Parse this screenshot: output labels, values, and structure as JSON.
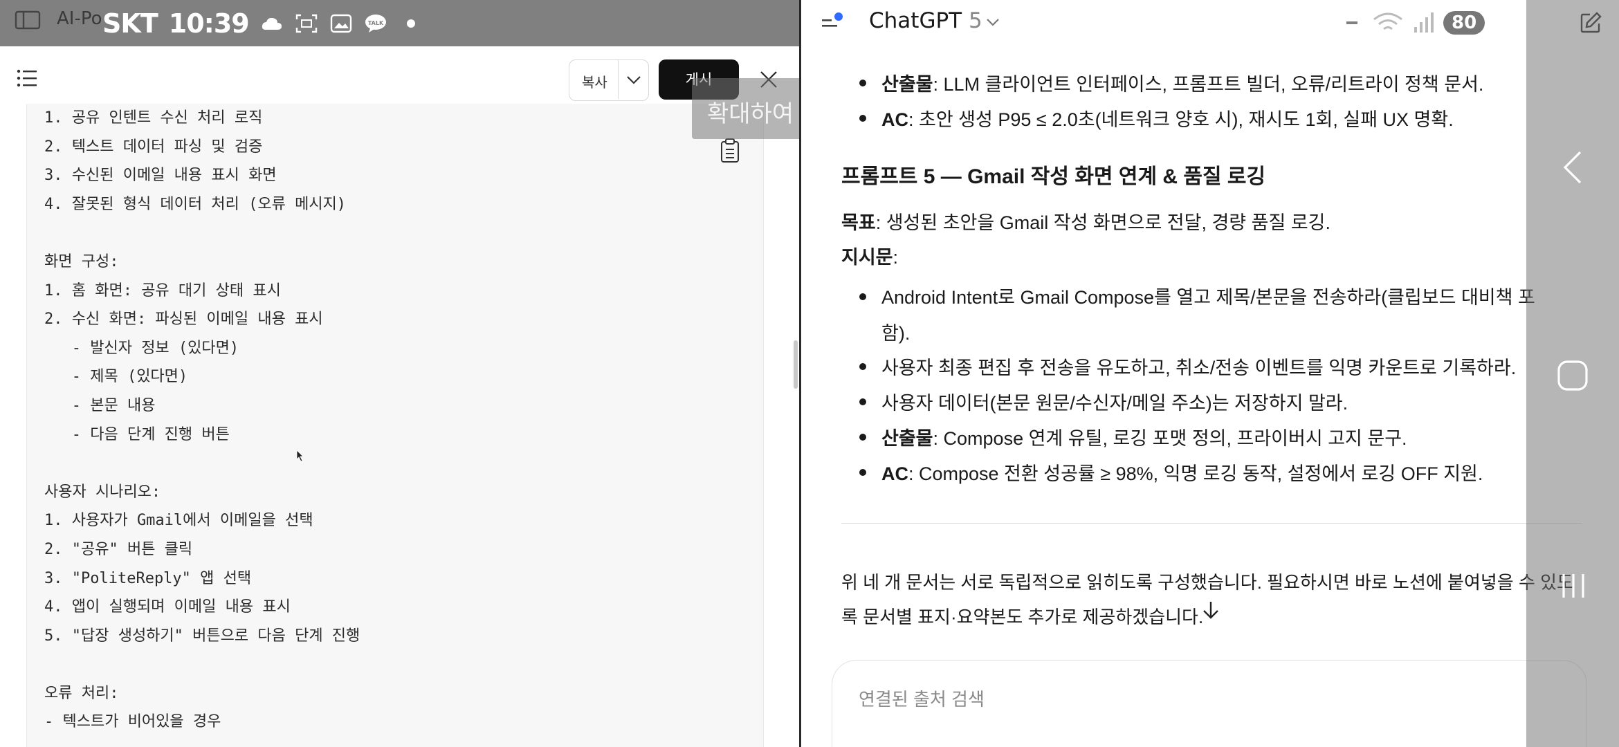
{
  "status_bar": {
    "carrier": "SKT",
    "time": "10:39",
    "battery": "80",
    "talk_badge": "TALK"
  },
  "left_pane": {
    "tab_title": "AI-Po",
    "copy_label": "복사",
    "post_label": "게시",
    "toast_text": "확대하여 화면 채움",
    "doc_lines": [
      "1. 공유 인텐트 수신 처리 로직",
      "2. 텍스트 데이터 파싱 및 검증",
      "3. 수신된 이메일 내용 표시 화면",
      "4. 잘못된 형식 데이터 처리 (오류 메시지)",
      "",
      "화면 구성:",
      "1. 홈 화면: 공유 대기 상태 표시",
      "2. 수신 화면: 파싱된 이메일 내용 표시",
      "   - 발신자 정보 (있다면)",
      "   - 제목 (있다면)",
      "   - 본문 내용",
      "   - 다음 단계 진행 버튼",
      "",
      "사용자 시나리오:",
      "1. 사용자가 Gmail에서 이메일을 선택",
      "2. \"공유\" 버튼 클릭",
      "3. \"PoliteReply\" 앱 선택",
      "4. 앱이 실행되며 이메일 내용 표시",
      "5. \"답장 생성하기\" 버튼으로 다음 단계 진행",
      "",
      "오류 처리:",
      "- 텍스트가 비어있을 경우"
    ]
  },
  "right_pane": {
    "app_name": "ChatGPT",
    "model_version": "5",
    "bullets_top": [
      {
        "bold": "산출물",
        "text": ": LLM 클라이언트 인터페이스, 프롬프트 빌더, 오류/리트라이 정책 문서."
      },
      {
        "bold": "AC",
        "text": ": 초안 생성 P95 ≤ 2.0초(네트워크 양호 시), 재시도 1회, 실패 UX 명확."
      }
    ],
    "section_heading": "프롬프트 5 — Gmail 작성 화면 연계 & 품질 로깅",
    "goal_label": "목표",
    "goal_text": ": 생성된 초안을 Gmail 작성 화면으로 전달, 경량 품질 로깅.",
    "instructions_label": "지시문",
    "instructions_colon": ":",
    "bullets_main": [
      {
        "bold": "",
        "line1": "Android Intent로 Gmail Compose를 열고 제목/본문을 전송하라(클립보드 대비책 포",
        "line2": "함)."
      },
      {
        "bold": "",
        "line1": "사용자 최종 편집 후 전송을 유도하고, 취소/전송 이벤트를 익명 카운트로 기록하라.",
        "line2": ""
      },
      {
        "bold": "",
        "line1": "사용자 데이터(본문 원문/수신자/메일 주소)는 저장하지 말라.",
        "line2": ""
      },
      {
        "bold": "산출물",
        "line1": ": Compose 연계 유틸, 로깅 포맷 정의, 프라이버시 고지 문구.",
        "line2": ""
      },
      {
        "bold": "AC",
        "line1": ": Compose 전환 성공률 ≥ 98%, 익명 로깅 동작, 설정에서 로깅 OFF 지원.",
        "line2": ""
      }
    ],
    "closing_line1": "위 네 개 문서는 서로 독립적으로 읽히도록 구성했습니다. 필요하시면 바로 노션에 붙여넣을 수 있도",
    "closing_line2": "록 문서별 표지·요약본도 추가로 제공하겠습니다.",
    "composer_placeholder": "연결된 출처 검색"
  },
  "icons": [
    "sidebar-icon",
    "cloud-icon",
    "screenshot-icon",
    "gallery-icon",
    "talk-icon",
    "outline-icon",
    "chevron-down-icon",
    "close-icon",
    "clipboard-icon",
    "hamburger-icon",
    "mute-icon",
    "wifi-icon",
    "signal-icon",
    "edit-icon",
    "arrow-down-icon",
    "back-icon",
    "home-icon",
    "recents-icon"
  ]
}
